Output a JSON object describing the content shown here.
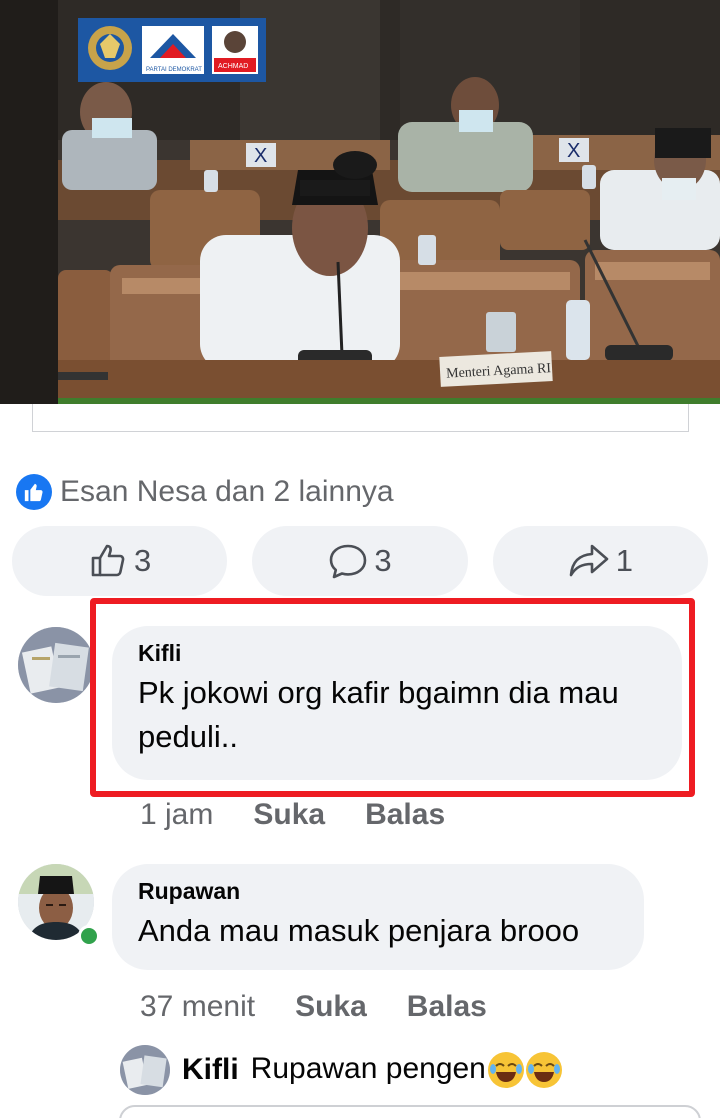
{
  "video": {
    "nameplate": "Menteri Agama RI",
    "logos": [
      {
        "name": "dpr-emblem-logo"
      },
      {
        "name": "partai-demokrat-logo",
        "caption": "PARTAI DEMOKRAT"
      },
      {
        "name": "achmad-logo",
        "caption": "ACHMAD"
      }
    ]
  },
  "reactions": {
    "summary": "Esan Nesa dan 2 lainnya",
    "like_count": "3",
    "comment_count": "3",
    "share_count": "1"
  },
  "comments": [
    {
      "author": "Kifli",
      "text_line1": "Pk jokowi org kafir bgaimn dia mau",
      "text_line2": "peduli..",
      "time": "1 jam",
      "like_label": "Suka",
      "reply_label": "Balas"
    },
    {
      "author": "Rupawan",
      "text": "Anda mau masuk penjara brooo",
      "time": "37 menit",
      "like_label": "Suka",
      "reply_label": "Balas"
    }
  ],
  "reply": {
    "author": "Kifli",
    "text": "Rupawan pengen"
  },
  "colors": {
    "accent": "#1877f2",
    "highlight": "#ee1c22",
    "online": "#31a24c",
    "bubble": "#f0f2f5"
  }
}
